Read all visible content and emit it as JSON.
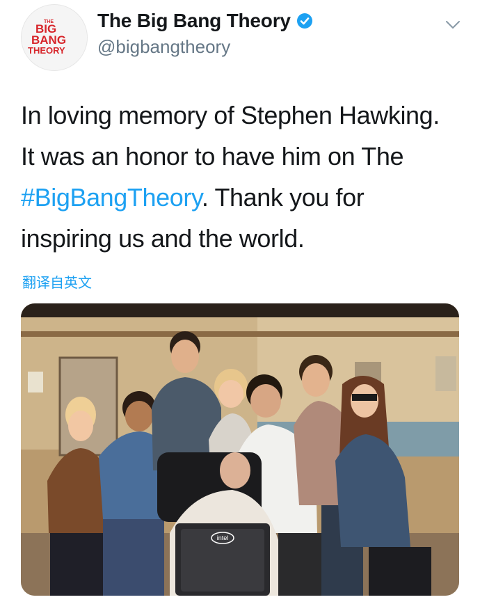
{
  "tweet": {
    "avatar_logo_lines": [
      "THE",
      "BIG",
      "BANG",
      "THEORY"
    ],
    "display_name": "The Big Bang Theory",
    "verified": true,
    "handle": "@bigbangtheory",
    "text_lines": [
      "In loving memory of Stephen Hawking.",
      "It was an honor to have him on The"
    ],
    "hashtag": "#BigBangTheory",
    "after_hashtag": ". Thank you for",
    "last_line": "inspiring us and the world.",
    "translate_label": "翻译自英文",
    "photo_logo": "intel"
  },
  "icons": {
    "verified": "verified-badge-icon",
    "caret": "chevron-down-icon"
  },
  "colors": {
    "link": "#1da1f2",
    "verified": "#1da1f2",
    "text": "#14171a",
    "secondary": "#657786",
    "logo_red": "#d7262b"
  }
}
